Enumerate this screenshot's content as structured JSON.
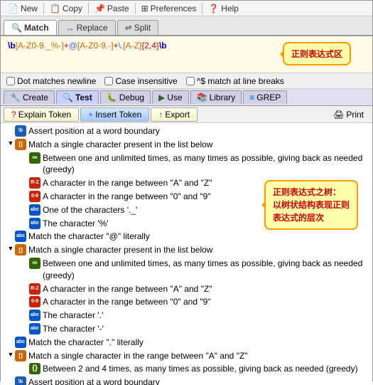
{
  "toolbar": {
    "new_label": "New",
    "copy_label": "Copy",
    "paste_label": "Paste",
    "preferences_label": "Preferences",
    "help_label": "Help"
  },
  "tabs": {
    "match_label": "Match",
    "replace_label": "Replace",
    "split_label": "Split"
  },
  "regex": {
    "display": "\\b[A-Z0-9._%-]+@[A-Z0-9.-]+\\.[A-Z]{2,4}\\b",
    "tooltip": "正则表达式区"
  },
  "options": {
    "dot_matches": "Dot matches newline",
    "case_insensitive": "Case insensitive",
    "caret_match": "^$ match at line breaks"
  },
  "sub_tabs": {
    "create_label": "Create",
    "test_label": "Test",
    "debug_label": "Debug",
    "use_label": "Use",
    "library_label": "Library",
    "grep_label": "GREP"
  },
  "action_tabs": {
    "explain_label": "Explain Token",
    "insert_label": "Insert Token",
    "export_label": "Export",
    "print_label": "Print"
  },
  "tree_tooltip": {
    "text": "正则表达式之树：\n以树状结构表现正则\n表达式的层次",
    "line1": "正则表达式之树：",
    "line2": "以树状结构表现正则",
    "line3": "表达式的层次"
  },
  "tree_items": [
    {
      "level": 0,
      "expand": "",
      "icon": "blue",
      "icon_text": "\\b",
      "text": "Assert position at a word boundary"
    },
    {
      "level": 0,
      "expand": "▼",
      "icon": "orange",
      "icon_text": "[]",
      "text": "Match a single character present in the list below"
    },
    {
      "level": 1,
      "expand": "",
      "icon": "green",
      "icon_text": "∞",
      "text": "Between one and unlimited times, as many times as possible, giving back as needed (greedy)"
    },
    {
      "level": 1,
      "expand": "",
      "icon": "rz",
      "icon_text": "R-Z",
      "text": "A character in the range between \"A\" and \"Z\""
    },
    {
      "level": 1,
      "expand": "",
      "icon": "rz",
      "icon_text": "0-9",
      "text": "A character in the range between \"0\" and \"9\""
    },
    {
      "level": 1,
      "expand": "",
      "icon": "abc",
      "icon_text": "abc",
      "text": "One of the characters '._'"
    },
    {
      "level": 1,
      "expand": "",
      "icon": "abc",
      "icon_text": "abc",
      "text": "The character '%'"
    },
    {
      "level": 0,
      "expand": "",
      "icon": "abc",
      "icon_text": "@",
      "text": "Match the character \"@\" literally"
    },
    {
      "level": 0,
      "expand": "▼",
      "icon": "orange",
      "icon_text": "[]",
      "text": "Match a single character present in the list below"
    },
    {
      "level": 1,
      "expand": "",
      "icon": "green",
      "icon_text": "∞",
      "text": "Between one and unlimited times, as many times as possible, giving back as needed (greedy)"
    },
    {
      "level": 1,
      "expand": "",
      "icon": "rz",
      "icon_text": "R-Z",
      "text": "A character in the range between \"A\" and \"Z\""
    },
    {
      "level": 1,
      "expand": "",
      "icon": "rz",
      "icon_text": "0-9",
      "text": "A character in the range between \"0\" and \"9\""
    },
    {
      "level": 1,
      "expand": "",
      "icon": "abc",
      "icon_text": "abc",
      "text": "The character '.'"
    },
    {
      "level": 1,
      "expand": "",
      "icon": "abc",
      "icon_text": "abc",
      "text": "The character '-'"
    },
    {
      "level": 0,
      "expand": "",
      "icon": "abc",
      "icon_text": ".",
      "text": "Match the character \".\" literally"
    },
    {
      "level": 0,
      "expand": "▼",
      "icon": "orange",
      "icon_text": "[]",
      "text": "Match a single character in the range between \"A\" and \"Z\""
    },
    {
      "level": 1,
      "expand": "",
      "icon": "green",
      "icon_text": "{}",
      "text": "Between 2 and 4 times, as many times as possible, giving back as needed (greedy)"
    },
    {
      "level": 0,
      "expand": "",
      "icon": "blue",
      "icon_text": "\\b",
      "text": "Assert position at a word boundary"
    }
  ]
}
